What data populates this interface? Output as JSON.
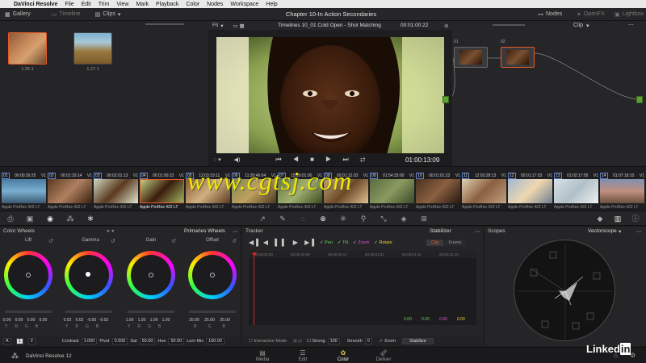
{
  "menubar": {
    "app": "DaVinci Resolve",
    "items": [
      "File",
      "Edit",
      "Trim",
      "View",
      "Mark",
      "Playback",
      "Color",
      "Nodes",
      "Workspace",
      "Help"
    ]
  },
  "toolbar": {
    "gallery": "Gallery",
    "timeline": "Timeline",
    "clips": "Clips",
    "title": "Chapter 10-In Action Secondaries",
    "nodes": "Nodes",
    "openfx": "OpenFX",
    "lightbox": "Lightbox"
  },
  "gallery": {
    "stills": [
      {
        "label": "1.25.1"
      },
      {
        "label": "1.27.1"
      }
    ]
  },
  "viewer": {
    "fit": "Fit",
    "timeline_name": "Timelines 10_01 Cold Open - Shot Matching",
    "timecode_top": "00:01:00:22",
    "timecode": "01:00:13:09",
    "mode": "Clip"
  },
  "nodes": {
    "items": [
      {
        "label": "01"
      },
      {
        "label": "02"
      }
    ]
  },
  "timeline": {
    "clips": [
      {
        "num": "01",
        "tc": "00:00:26:25",
        "track": "V1",
        "codec": "Apple ProRes 422 LT"
      },
      {
        "num": "02",
        "tc": "00:01:10:14",
        "track": "V1",
        "codec": "Apple ProRes 422 LT"
      },
      {
        "num": "03",
        "tc": "00:02:01:13",
        "track": "V1",
        "codec": "Apple ProRes 422 LT"
      },
      {
        "num": "04",
        "tc": "00:01:00:22",
        "track": "V1",
        "codec": "Apple ProRes 422 LT"
      },
      {
        "num": "05",
        "tc": "12:03:19:11",
        "track": "V1",
        "codec": "Apple ProRes 422 LT"
      },
      {
        "num": "06",
        "tc": "11:20:46:04",
        "track": "V1",
        "codec": "Apple ProRes 422 LT"
      },
      {
        "num": "07",
        "tc": "15:19:01:00",
        "track": "V1",
        "codec": "Apple ProRes 422 LT"
      },
      {
        "num": "08",
        "tc": "00:01:12:03",
        "track": "V1",
        "codec": "Apple ProRes 422 LT"
      },
      {
        "num": "09",
        "tc": "01:54:33:00",
        "track": "V1",
        "codec": "Apple ProRes 422 LT"
      },
      {
        "num": "10",
        "tc": "00:01:01:22",
        "track": "V1",
        "codec": "Apple ProRes 422 LT"
      },
      {
        "num": "11",
        "tc": "12:03:28:13",
        "track": "V1",
        "codec": "Apple ProRes 422 LT"
      },
      {
        "num": "12",
        "tc": "00:01:17:03",
        "track": "V1",
        "codec": "Apple ProRes 422 LT"
      },
      {
        "num": "13",
        "tc": "01:02:17:05",
        "track": "V1",
        "codec": "Apple ProRes 422 LT"
      },
      {
        "num": "14",
        "tc": "01:07:18:10",
        "track": "V1",
        "codec": "Apple ProRes 422 LT"
      }
    ]
  },
  "color_wheels": {
    "title": "Color Wheels",
    "mode": "Primaries Wheels",
    "wheels": [
      {
        "name": "Lift",
        "values": [
          "0.00",
          "0.00",
          "0.00",
          "0.00"
        ],
        "rgb": [
          "Y",
          "R",
          "G",
          "B"
        ]
      },
      {
        "name": "Gamma",
        "values": [
          "0.02",
          "0.02",
          "-0.00",
          "-0.03"
        ],
        "rgb": [
          "Y",
          "R",
          "G",
          "B"
        ]
      },
      {
        "name": "Gain",
        "values": [
          "1.00",
          "1.00",
          "1.00",
          "1.00"
        ],
        "rgb": [
          "Y",
          "R",
          "G",
          "B"
        ]
      },
      {
        "name": "Offset",
        "values": [
          "25.00",
          "25.00",
          "25.00",
          "25.00"
        ],
        "rgb": [
          "R",
          "G",
          "B"
        ]
      }
    ],
    "footer": {
      "a": "A",
      "p1": "1",
      "p2": "2",
      "contrast_label": "Contrast",
      "contrast": "1.000",
      "pivot_label": "Pivot",
      "pivot": "0.500",
      "sat_label": "Sat",
      "sat": "50.00",
      "hue_label": "Hue",
      "hue": "50.00",
      "lummix_label": "Lum Mix",
      "lummix": "100.00"
    }
  },
  "tracker": {
    "title": "Tracker",
    "mode": "Stabilizer",
    "checks": [
      "Pan",
      "Tilt",
      "Zoom",
      "Rotate"
    ],
    "clip": "Clip",
    "frame": "Frame",
    "ticks": [
      "00:00:00:00",
      "00:00:00:09",
      "00:00:00:17",
      "00:00:01:02",
      "00:00:01:10",
      "00:00:01:19"
    ],
    "readouts": [
      "0.00",
      "0.00",
      "0.00",
      "0.00"
    ],
    "footer": {
      "interactive": "Interactive Mode",
      "strong_label": "Strong",
      "strong": "100",
      "smooth_label": "Smooth",
      "smooth": "0",
      "zoom": "Zoom",
      "stabilize": "Stabilize"
    }
  },
  "scopes": {
    "title": "Scopes",
    "type": "Vectorscope"
  },
  "pages": {
    "media": "Media",
    "edit": "Edit",
    "color": "Color",
    "deliver": "Deliver",
    "product": "DaVinci Resolve 12"
  },
  "watermark": "www.cgtsj.com",
  "brand": {
    "linked": "Linked",
    "in": "in"
  },
  "colors": {
    "accent": "#e55a27",
    "active_tab": "#d9c84a"
  }
}
